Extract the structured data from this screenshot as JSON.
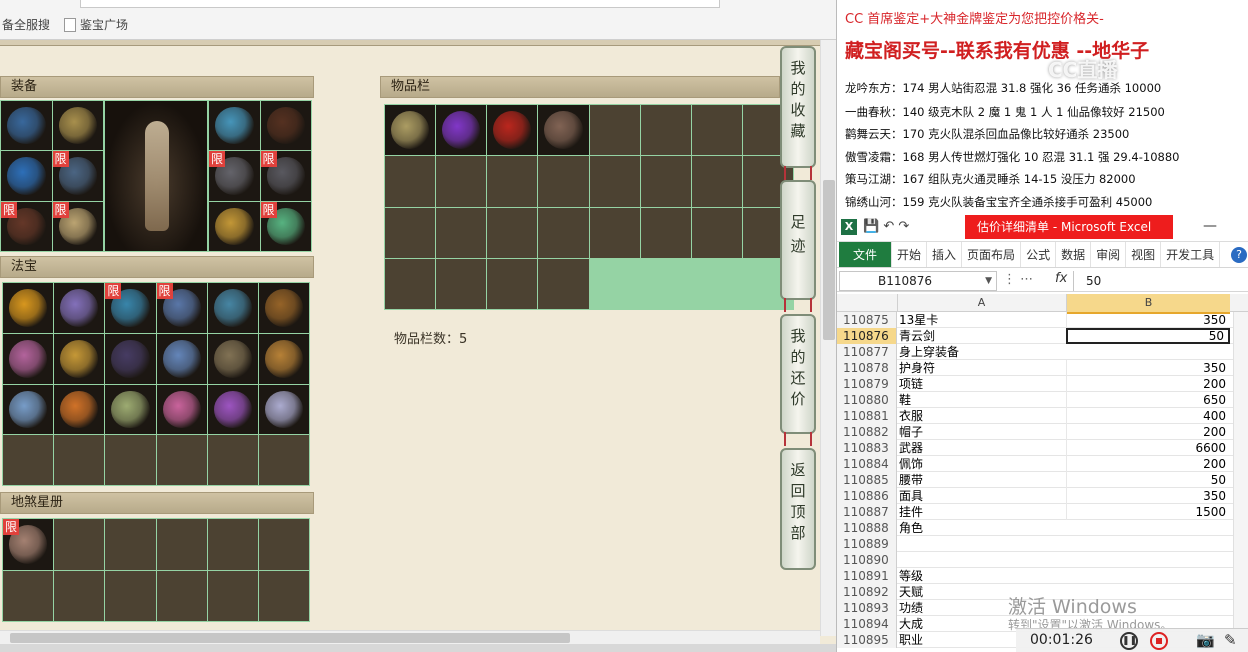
{
  "browser": {
    "favorites": [
      "备全服搜",
      "鉴宝广场"
    ]
  },
  "equip": {
    "title": "装备",
    "left_slots": [
      {
        "badge": "",
        "color": "#3b6fa8"
      },
      {
        "badge": "",
        "color": "#b49a52"
      },
      {
        "badge": "",
        "color": "#2f77c7"
      },
      {
        "badge": "限",
        "color": "#4f6c8d"
      },
      {
        "badge": "限",
        "color": "#6b3a2a"
      },
      {
        "badge": "限",
        "color": "#c9b07a"
      }
    ],
    "right_slots": [
      {
        "badge": "",
        "color": "#4aa0c8"
      },
      {
        "badge": "",
        "color": "#5a3322"
      },
      {
        "badge": "限",
        "color": "#6a6a72"
      },
      {
        "badge": "限",
        "color": "#5e5e66"
      },
      {
        "badge": "",
        "color": "#d1a23a"
      },
      {
        "badge": "限",
        "color": "#5cc08a"
      }
    ]
  },
  "fabao": {
    "title": "法宝",
    "slots": [
      {
        "badge": "",
        "color": "#e8a21f"
      },
      {
        "badge": "",
        "color": "#8c78c9"
      },
      {
        "badge": "限",
        "color": "#3b8fb8"
      },
      {
        "badge": "限",
        "color": "#5f7fb5"
      },
      {
        "badge": "",
        "color": "#4a8fb0"
      },
      {
        "badge": "",
        "color": "#a06a2a"
      },
      {
        "badge": "",
        "color": "#c06aa8"
      },
      {
        "badge": "",
        "color": "#d4a33a"
      },
      {
        "badge": "",
        "color": "#4a3f6a"
      },
      {
        "badge": "",
        "color": "#6a8fc8"
      },
      {
        "badge": "",
        "color": "#8a7a5a"
      },
      {
        "badge": "",
        "color": "#c48a3a"
      },
      {
        "badge": "",
        "color": "#7fa8d8"
      },
      {
        "badge": "",
        "color": "#e07a2a"
      },
      {
        "badge": "",
        "color": "#a8b87a"
      },
      {
        "badge": "",
        "color": "#d86aa8"
      },
      {
        "badge": "",
        "color": "#a85ad0"
      },
      {
        "badge": "",
        "color": "#b8b8e0"
      },
      {
        "badge": "",
        "color": ""
      },
      {
        "badge": "",
        "color": ""
      },
      {
        "badge": "",
        "color": ""
      },
      {
        "badge": "",
        "color": ""
      },
      {
        "badge": "",
        "color": ""
      },
      {
        "badge": "",
        "color": ""
      }
    ]
  },
  "dishabook": {
    "title": "地煞星册",
    "slots": [
      {
        "badge": "限",
        "color": "#b08a7a"
      },
      {
        "badge": "",
        "color": ""
      },
      {
        "badge": "",
        "color": ""
      },
      {
        "badge": "",
        "color": ""
      },
      {
        "badge": "",
        "color": ""
      },
      {
        "badge": "",
        "color": ""
      },
      {
        "badge": "",
        "color": ""
      },
      {
        "badge": "",
        "color": ""
      },
      {
        "badge": "",
        "color": ""
      },
      {
        "badge": "",
        "color": ""
      },
      {
        "badge": "",
        "color": ""
      },
      {
        "badge": "",
        "color": ""
      }
    ]
  },
  "inventory": {
    "title": "物品栏",
    "count_label": "物品栏数：5",
    "slots": [
      {
        "badge": "",
        "color": "#b8a86a"
      },
      {
        "badge": "",
        "color": "#8a3ad8"
      },
      {
        "badge": "",
        "color": "#c8281f"
      },
      {
        "badge": "",
        "color": "#8a6a5a"
      }
    ],
    "total_slots": 28
  },
  "sidenav": {
    "items": [
      {
        "label": "我的收藏",
        "chars": [
          "我",
          "的",
          "收",
          "藏"
        ]
      },
      {
        "label": "足迹",
        "chars": [
          "足",
          "迹"
        ]
      },
      {
        "label": "我的还价",
        "chars": [
          "我",
          "的",
          "还",
          "价"
        ]
      },
      {
        "label": "返回顶部",
        "chars": [
          "返",
          "回",
          "顶",
          "部"
        ]
      }
    ]
  },
  "doc": {
    "line1": "CC 首席鉴定+大神金牌鉴定为您把控价格关-",
    "line2": "藏宝阁买号--联系我有优惠 --地华子",
    "rows": [
      "龙吟东方：174 男人站街忍混 31.8 强化 36 任务通杀 10000",
      "一曲春秋：140 级克木队 2 魔 1 鬼 1 人 1 仙品像较好 21500",
      "鹳舞云天：170 克火队混杀回血品像比较好通杀 23500",
      "傲雪凌霜：168 男人传世燃灯强化 10 忍混 31.1 强 29.4-10880",
      "策马江湖：167 组队克火通灵睡杀 14-15 没压力 82000",
      "锦绣山河：159 克火队装备宝宝齐全通杀接手可盈利 45000"
    ],
    "watermark": "CC直播"
  },
  "excel": {
    "qat_icons": [
      "save-icon",
      "undo-icon",
      "redo-icon"
    ],
    "window_title": "估价详细清单 - Microsoft Excel",
    "min_glyph": "—",
    "tabs": [
      "开始",
      "插入",
      "页面布局",
      "公式",
      "数据",
      "审阅",
      "视图",
      "开发工具"
    ],
    "file_tab": "文件",
    "name_box": "B110876",
    "fx_glyph": "fx",
    "formula_value": "50",
    "columns": [
      "A",
      "B"
    ],
    "rows": [
      {
        "n": "110875",
        "a": "13星卡",
        "b": "350"
      },
      {
        "n": "110876",
        "a": "青云剑",
        "b": "50"
      },
      {
        "n": "110877",
        "a": "身上穿装备",
        "b": ""
      },
      {
        "n": "110878",
        "a": "护身符",
        "b": "350"
      },
      {
        "n": "110879",
        "a": "项链",
        "b": "200"
      },
      {
        "n": "110880",
        "a": "鞋",
        "b": "650"
      },
      {
        "n": "110881",
        "a": "衣服",
        "b": "400"
      },
      {
        "n": "110882",
        "a": "帽子",
        "b": "200"
      },
      {
        "n": "110883",
        "a": "武器",
        "b": "6600"
      },
      {
        "n": "110884",
        "a": "佩饰",
        "b": "200"
      },
      {
        "n": "110885",
        "a": "腰带",
        "b": "50"
      },
      {
        "n": "110886",
        "a": "面具",
        "b": "350"
      },
      {
        "n": "110887",
        "a": "挂件",
        "b": "1500"
      },
      {
        "n": "110888",
        "a": "角色",
        "b": ""
      },
      {
        "n": "110889",
        "a": "",
        "b": ""
      },
      {
        "n": "110890",
        "a": "",
        "b": ""
      },
      {
        "n": "110891",
        "a": "等级",
        "b": ""
      },
      {
        "n": "110892",
        "a": "天赋",
        "b": ""
      },
      {
        "n": "110893",
        "a": "功绩",
        "b": ""
      },
      {
        "n": "110894",
        "a": "大成",
        "b": ""
      },
      {
        "n": "110895",
        "a": "职业",
        "b": ""
      }
    ],
    "active_row": "110876"
  },
  "os": {
    "activate_title": "激活 Windows",
    "activate_sub": "转到\"设置\"以激活 Windows。"
  },
  "recorder": {
    "time": "00:01:26"
  }
}
